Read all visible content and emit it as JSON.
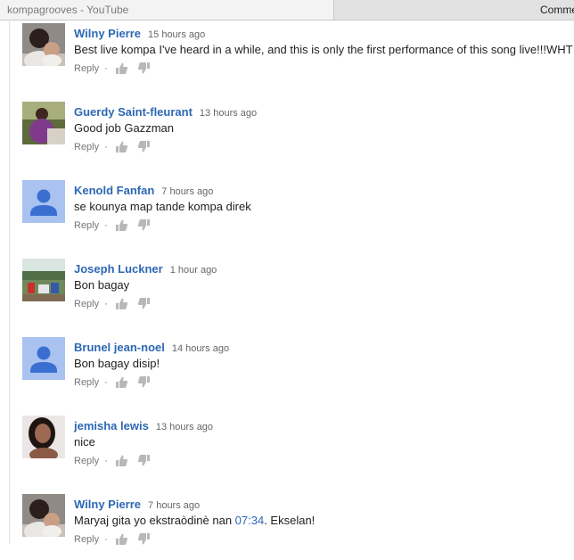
{
  "browser": {
    "active_tab_title": "kompagrooves - YouTube",
    "second_tab_title": "Comme"
  },
  "comments": [
    {
      "author": "Wilny Pierre",
      "time": "15 hours ago",
      "text": "Best live kompa I've heard in a while, and this is only the first performance of this song live!!!WHT",
      "reply_label": "Reply",
      "avatar": "photo-man-baby"
    },
    {
      "author": "Guerdy Saint-fleurant",
      "time": "13 hours ago",
      "text": "Good job Gazzman",
      "reply_label": "Reply",
      "avatar": "photo-woman-purple"
    },
    {
      "author": "Kenold Fanfan",
      "time": "7 hours ago",
      "text": "se kounya map tande  kompa direk",
      "reply_label": "Reply",
      "avatar": "default-avatar"
    },
    {
      "author": "Joseph Luckner",
      "time": "1 hour ago",
      "text": "Bon bagay",
      "reply_label": "Reply",
      "avatar": "photo-happy-card",
      "avatar_caption": "Happy"
    },
    {
      "author": "Brunel jean-noel",
      "time": "14 hours ago",
      "text": "Bon bagay disip!",
      "reply_label": "Reply",
      "avatar": "default-avatar"
    },
    {
      "author": "jemisha lewis",
      "time": "13 hours ago",
      "text": "nice",
      "reply_label": "Reply",
      "avatar": "photo-woman-portrait"
    },
    {
      "author": "Wilny Pierre",
      "time": "7 hours ago",
      "text_before": "Maryaj gita yo ekstraòdinè nan ",
      "timestamp_link": "07:34",
      "text_after": ". Ekselan!",
      "reply_label": "Reply",
      "avatar": "photo-man-baby"
    }
  ]
}
